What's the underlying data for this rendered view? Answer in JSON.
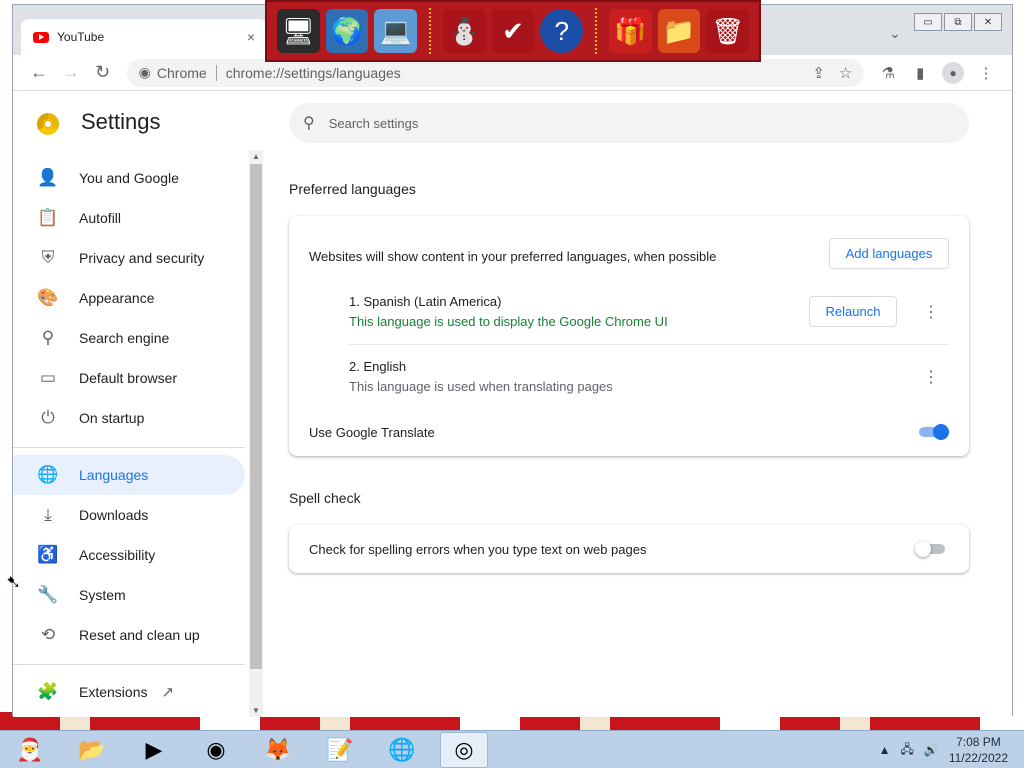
{
  "browser": {
    "tab_title": "YouTube",
    "tab_close": "×",
    "omnibox_site": "Chrome",
    "omnibox_url": "chrome://settings/languages",
    "window_buttons": [
      "▭",
      "⧉",
      "✕"
    ]
  },
  "settings": {
    "title": "Settings",
    "search_placeholder": "Search settings",
    "nav": [
      {
        "label": "You and Google",
        "icon": "person-icon"
      },
      {
        "label": "Autofill",
        "icon": "clipboard-icon"
      },
      {
        "label": "Privacy and security",
        "icon": "shield-icon"
      },
      {
        "label": "Appearance",
        "icon": "palette-icon"
      },
      {
        "label": "Search engine",
        "icon": "search-icon"
      },
      {
        "label": "Default browser",
        "icon": "browser-icon"
      },
      {
        "label": "On startup",
        "icon": "power-icon"
      },
      {
        "label": "Languages",
        "icon": "globe-icon",
        "active": true
      },
      {
        "label": "Downloads",
        "icon": "download-icon"
      },
      {
        "label": "Accessibility",
        "icon": "accessibility-icon"
      },
      {
        "label": "System",
        "icon": "wrench-icon"
      },
      {
        "label": "Reset and clean up",
        "icon": "history-icon"
      },
      {
        "label": "Extensions",
        "icon": "puzzle-icon"
      }
    ],
    "preferred_languages": {
      "heading": "Preferred languages",
      "description": "Websites will show content in your preferred languages, when possible",
      "add_button": "Add languages",
      "languages": [
        {
          "name": "1. Spanish (Latin America)",
          "note": "This language is used to display the Google Chrome UI",
          "action": "Relaunch"
        },
        {
          "name": "2. English",
          "note": "This language is used when translating pages"
        }
      ],
      "translate_label": "Use Google Translate",
      "translate_on": true
    },
    "spell_check": {
      "heading": "Spell check",
      "label": "Check for spelling errors when you type text on web pages",
      "enabled": false
    }
  },
  "taskbar": {
    "time": "7:08 PM",
    "date": "11/22/2022"
  },
  "colors": {
    "accent": "#1a73e8",
    "active_nav_bg": "#e8f0fe",
    "note_green": "#188038"
  }
}
